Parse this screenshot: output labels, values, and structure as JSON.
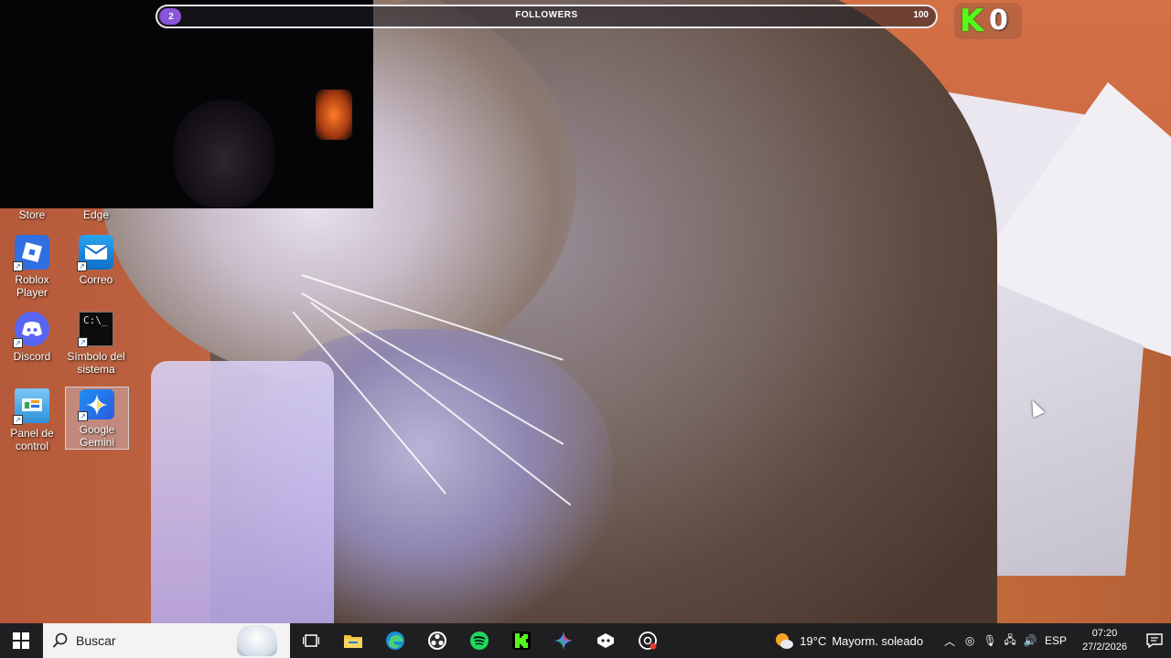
{
  "stream_overlay": {
    "followers": {
      "current": "2",
      "title": "FOLLOWERS",
      "goal": "100",
      "progress": 0.02
    },
    "kick": {
      "logo": "K",
      "count": "0"
    }
  },
  "desktop": {
    "partial_labels": [
      "Store",
      "Edge"
    ],
    "icons": [
      {
        "name": "roblox-player",
        "label_line1": "Roblox",
        "label_line2": "Player",
        "icon": "roblox-icon",
        "color": "#2f6fe0"
      },
      {
        "name": "correo",
        "label_line1": "Correo",
        "label_line2": "",
        "icon": "mail-icon",
        "color": "#0f7bd8"
      },
      {
        "name": "discord",
        "label_line1": "Discord",
        "label_line2": "",
        "icon": "discord-icon",
        "color": "#5865f2"
      },
      {
        "name": "simbolo-del-sistema",
        "label_line1": "Símbolo del",
        "label_line2": "sistema",
        "icon": "cmd-icon",
        "color": "#0c0c0c"
      },
      {
        "name": "panel-de-control",
        "label_line1": "Panel de",
        "label_line2": "control",
        "icon": "control-panel-icon",
        "color": "#3fa0e8"
      },
      {
        "name": "google-gemini",
        "label_line1": "Google",
        "label_line2": "Gemini",
        "icon": "gemini-icon",
        "color": "#4f8df7"
      }
    ]
  },
  "taskbar": {
    "search_placeholder": "Buscar",
    "apps": [
      "task-view-icon",
      "file-explorer-icon",
      "edge-icon",
      "obs-icon",
      "spotify-icon",
      "kick-icon",
      "gemini-icon",
      "steam-icon",
      "chrome-icon"
    ],
    "weather": {
      "temp": "19°C",
      "text": "Mayorm. soleado"
    },
    "language": "ESP",
    "time": "07:20",
    "date": "27/2/2026"
  }
}
